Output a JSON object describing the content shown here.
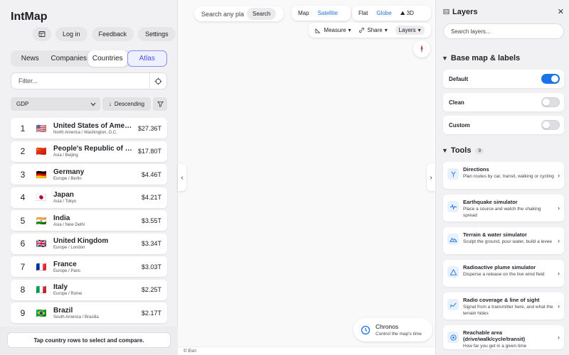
{
  "app": {
    "title": "IntMap"
  },
  "top_actions": {
    "login": "Log in",
    "feedback": "Feedback",
    "settings": "Settings"
  },
  "tabs": [
    {
      "label": "News",
      "state": "default"
    },
    {
      "label": "Companies",
      "state": "default"
    },
    {
      "label": "Countries",
      "state": "active"
    },
    {
      "label": "Atlas",
      "state": "outlined"
    }
  ],
  "filter": {
    "placeholder": "Filter..."
  },
  "sort": {
    "metric": "GDP",
    "order": "Descending"
  },
  "countries": [
    {
      "rank": "1",
      "flag": "🇺🇸",
      "name": "United States of America",
      "region": "North America / Washington, D.C.",
      "gdp": "$27.36T"
    },
    {
      "rank": "2",
      "flag": "🇨🇳",
      "name": "People's Republic of China",
      "region": "Asia / Beijing",
      "gdp": "$17.80T"
    },
    {
      "rank": "3",
      "flag": "🇩🇪",
      "name": "Germany",
      "region": "Europe / Berlin",
      "gdp": "$4.46T"
    },
    {
      "rank": "4",
      "flag": "🇯🇵",
      "name": "Japan",
      "region": "Asia / Tokyo",
      "gdp": "$4.21T"
    },
    {
      "rank": "5",
      "flag": "🇮🇳",
      "name": "India",
      "region": "Asia / New Delhi",
      "gdp": "$3.55T"
    },
    {
      "rank": "6",
      "flag": "🇬🇧",
      "name": "United Kingdom",
      "region": "Europe / London",
      "gdp": "$3.34T"
    },
    {
      "rank": "7",
      "flag": "🇫🇷",
      "name": "France",
      "region": "Europe / Paris",
      "gdp": "$3.03T"
    },
    {
      "rank": "8",
      "flag": "🇮🇹",
      "name": "Italy",
      "region": "Europe / Rome",
      "gdp": "$2.25T"
    },
    {
      "rank": "9",
      "flag": "🇧🇷",
      "name": "Brazil",
      "region": "South America / Brasilia",
      "gdp": "$2.17T"
    }
  ],
  "hint": "Tap country rows to select and compare.",
  "map": {
    "search_placeholder": "Search any pla",
    "search_button": "Search",
    "view_toggle": {
      "map": "Map",
      "satellite": "Satellite",
      "selected": "Satellite"
    },
    "proj_toggle": {
      "flat": "Flat",
      "globe": "Globe",
      "three_d": "3D",
      "selected": "Globe"
    },
    "tools": {
      "measure": "Measure",
      "share": "Share",
      "layers": "Layers"
    },
    "chronos": {
      "title": "Chronos",
      "subtitle": "Control the map's time"
    },
    "attribution": "© Esri"
  },
  "layers_panel": {
    "title": "Layers",
    "search_placeholder": "Search layers...",
    "basemap_title": "Base map & labels",
    "basemaps": [
      {
        "label": "Default",
        "on": true
      },
      {
        "label": "Clean",
        "on": false
      },
      {
        "label": "Custom",
        "on": false
      }
    ],
    "tools_title": "Tools",
    "tools_count": "9",
    "tools": [
      {
        "icon": "directions-icon",
        "name": "Directions",
        "desc": "Plan routes by car, transit, walking or cycling"
      },
      {
        "icon": "seismograph-icon",
        "name": "Earthquake simulator",
        "desc": "Place a source and watch the shaking spread"
      },
      {
        "icon": "terrain-icon",
        "name": "Terrain & water simulator",
        "desc": "Sculpt the ground, pour water, build a levee"
      },
      {
        "icon": "hazard-icon",
        "name": "Radioactive plume simulator",
        "desc": "Disperse a release on the live wind field"
      },
      {
        "icon": "signal-icon",
        "name": "Radio coverage & line of sight",
        "desc": "Signal from a transmitter here, and what the terrain hides"
      },
      {
        "icon": "target-icon",
        "name": "Reachable area (drive/walk/cycle/transit)",
        "desc": "How far you get in a given time"
      }
    ]
  },
  "colors": {
    "accent": "#1a73e8",
    "atlas_outline": "#8a8fe8"
  }
}
